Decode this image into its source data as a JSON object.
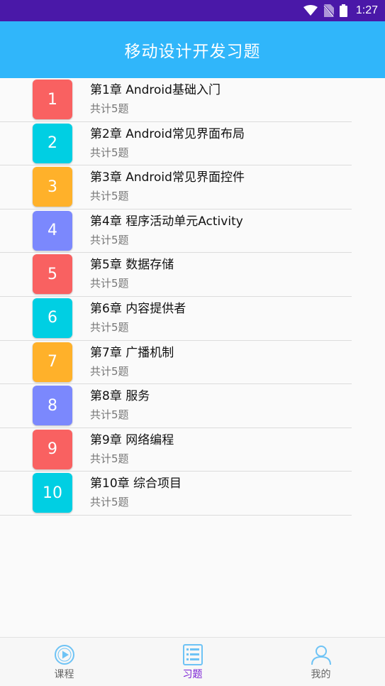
{
  "status_bar": {
    "time": "1:27",
    "icons": [
      "wifi-icon",
      "no-sim-icon",
      "battery-icon"
    ],
    "background": "#4a18a8"
  },
  "app_bar": {
    "title": "移动设计开发习题",
    "background": "#30b6fa"
  },
  "chapters": [
    {
      "number": "1",
      "title": "第1章 Android基础入门",
      "subtitle": "共计5题",
      "color": "#f96161"
    },
    {
      "number": "2",
      "title": "第2章 Android常见界面布局",
      "subtitle": "共计5题",
      "color": "#00cfe3"
    },
    {
      "number": "3",
      "title": "第3章 Android常见界面控件",
      "subtitle": "共计5题",
      "color": "#ffb12a"
    },
    {
      "number": "4",
      "title": "第4章 程序活动单元Activity",
      "subtitle": "共计5题",
      "color": "#7b88fd"
    },
    {
      "number": "5",
      "title": "第5章 数据存储",
      "subtitle": "共计5题",
      "color": "#f96161"
    },
    {
      "number": "6",
      "title": "第6章 内容提供者",
      "subtitle": "共计5题",
      "color": "#00cfe3"
    },
    {
      "number": "7",
      "title": "第7章 广播机制",
      "subtitle": "共计5题",
      "color": "#ffb12a"
    },
    {
      "number": "8",
      "title": "第8章 服务",
      "subtitle": "共计5题",
      "color": "#7b88fd"
    },
    {
      "number": "9",
      "title": "第9章 网络编程",
      "subtitle": "共计5题",
      "color": "#f96161"
    },
    {
      "number": "10",
      "title": "第10章 综合项目",
      "subtitle": "共计5题",
      "color": "#00cfe3"
    }
  ],
  "bottom_nav": {
    "items": [
      {
        "label": "课程",
        "icon": "play-circle-icon",
        "active": false
      },
      {
        "label": "习题",
        "icon": "list-icon",
        "active": true
      },
      {
        "label": "我的",
        "icon": "person-icon",
        "active": false
      }
    ],
    "active_color": "#7b1fd4",
    "inactive_icon_color": "#6ec3f5"
  }
}
